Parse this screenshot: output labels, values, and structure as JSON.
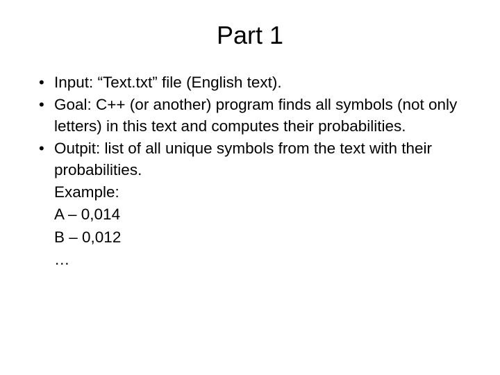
{
  "title": "Part 1",
  "bullets": [
    "Input: “Text.txt” file (English text).",
    "Goal: C++ (or another) program finds all symbols (not only letters) in this text and computes their probabilities.",
    "Outpit: list of all unique symbols from the text with their probabilities."
  ],
  "example": {
    "label": "Example:",
    "rows": [
      "A – 0,014",
      "B – 0,012",
      "…"
    ]
  }
}
